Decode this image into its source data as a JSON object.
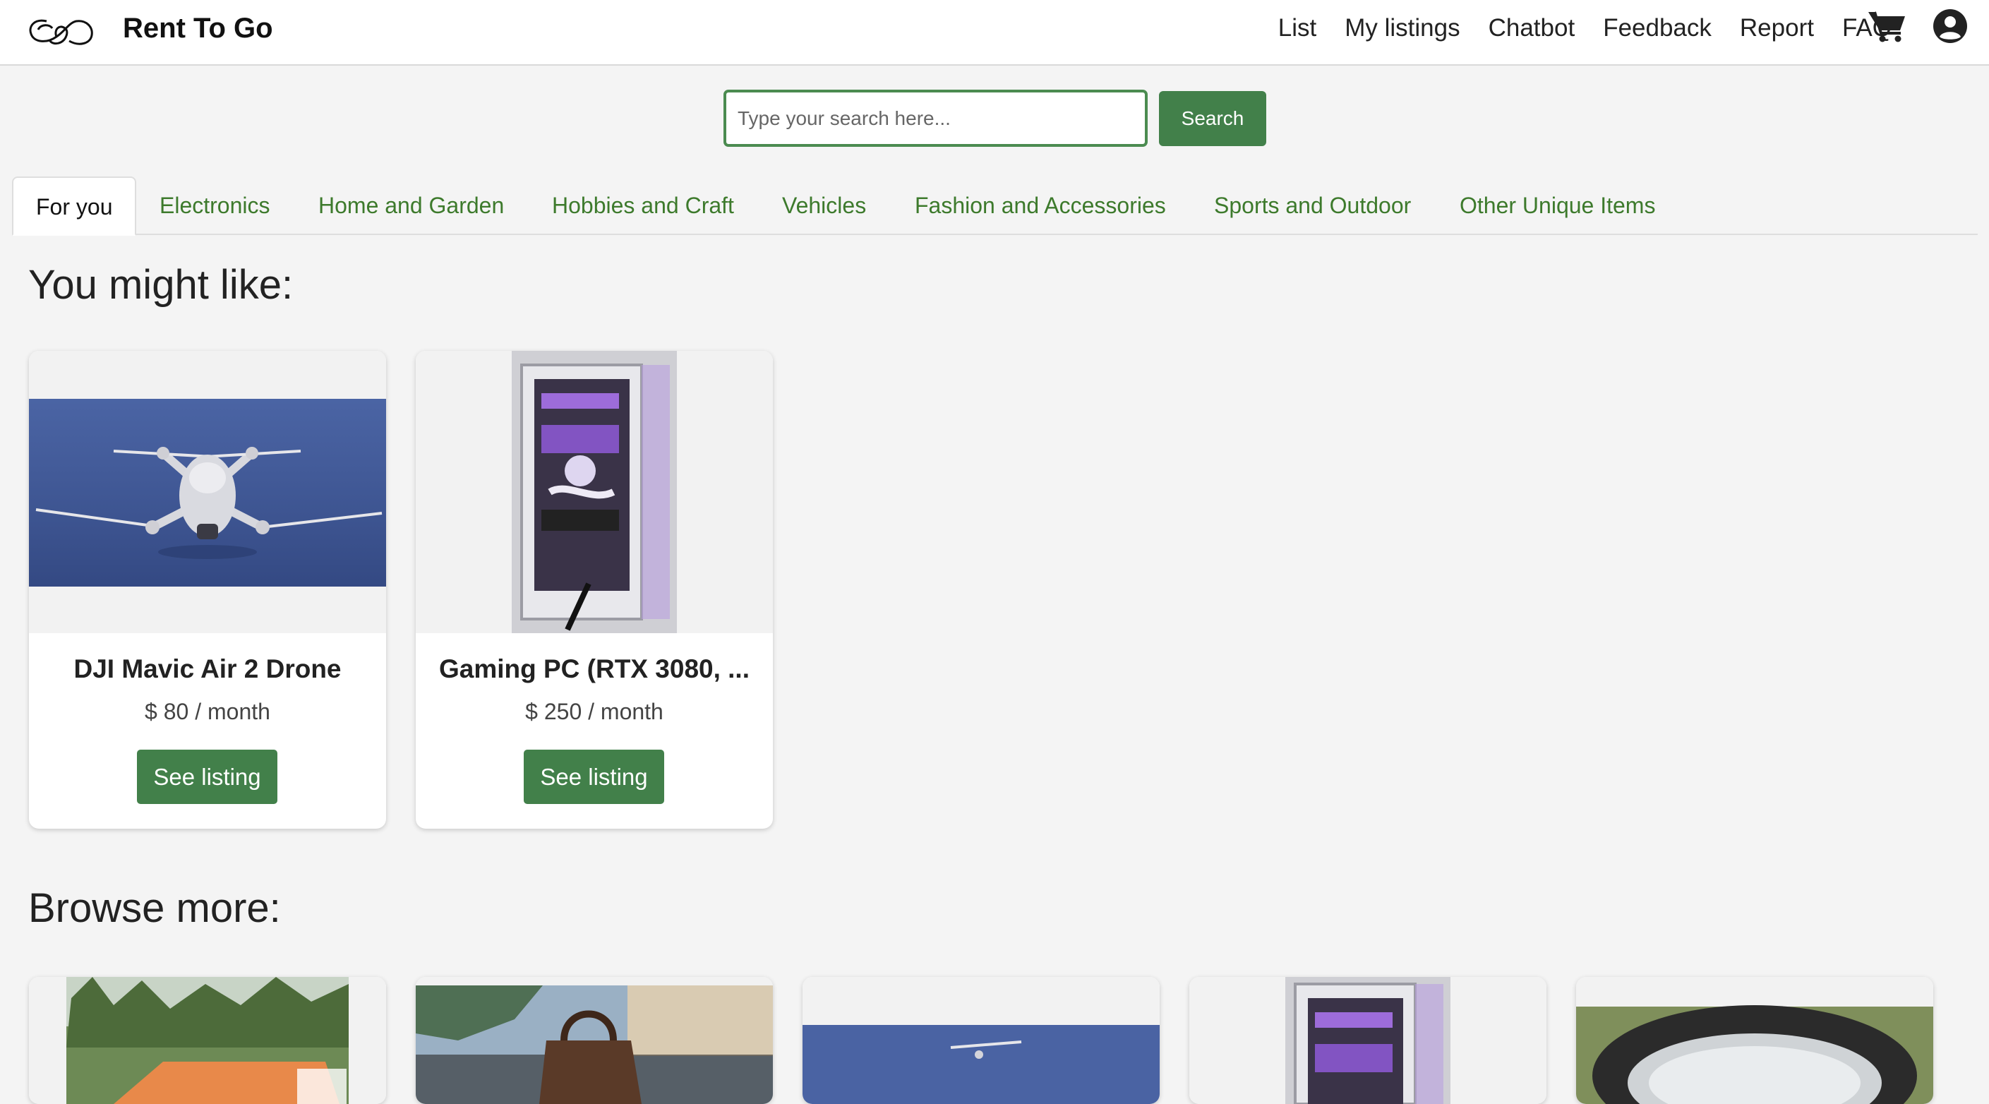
{
  "header": {
    "brand": "Rent To Go",
    "nav": [
      "List",
      "My listings",
      "Chatbot",
      "Feedback",
      "Report",
      "FAQ"
    ],
    "icons": [
      "logo-icon",
      "cart-icon",
      "user-icon"
    ]
  },
  "search": {
    "placeholder": "Type your search here...",
    "button_label": "Search"
  },
  "tabs": [
    {
      "label": "For you",
      "active": true
    },
    {
      "label": "Electronics"
    },
    {
      "label": "Home and Garden"
    },
    {
      "label": "Hobbies and Craft"
    },
    {
      "label": "Vehicles"
    },
    {
      "label": "Fashion and Accessories"
    },
    {
      "label": "Sports and Outdoor"
    },
    {
      "label": "Other Unique Items"
    }
  ],
  "recommended": {
    "heading": "You might like:",
    "items": [
      {
        "title": "DJI Mavic Air 2 Drone",
        "price": "$ 80 / month",
        "button": "See listing",
        "image": "drone"
      },
      {
        "title": "Gaming PC (RTX 3080, ...",
        "price": "$ 250 / month",
        "button": "See listing",
        "image": "gaming-pc"
      }
    ]
  },
  "browse": {
    "heading": "Browse more:",
    "items": [
      {
        "image": "tent"
      },
      {
        "image": "handbag"
      },
      {
        "image": "drone"
      },
      {
        "image": "gaming-pc"
      },
      {
        "image": "hot-tub"
      }
    ]
  },
  "colors": {
    "accent": "#42804a",
    "tab_text": "#3d7a2c",
    "background": "#f4f4f4"
  }
}
